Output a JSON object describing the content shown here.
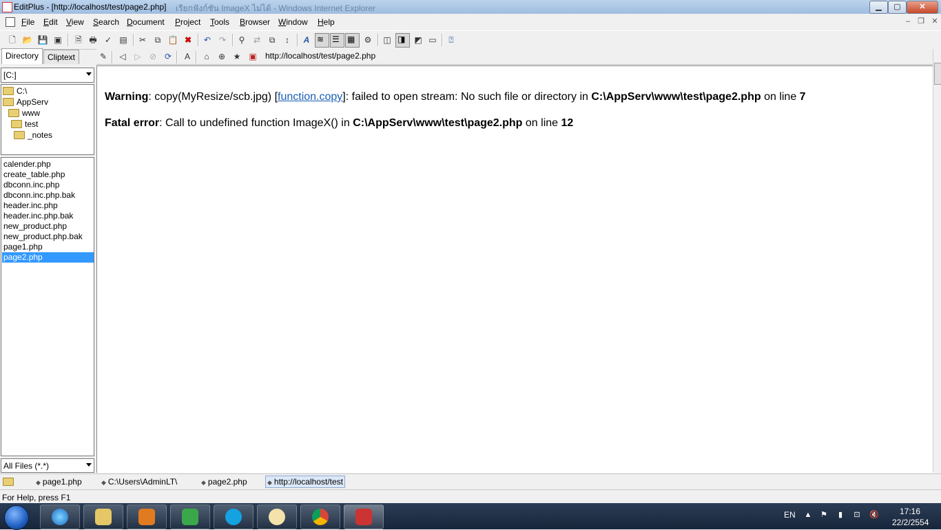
{
  "window": {
    "title": "EditPlus - [http://localhost/test/page2.php]",
    "ghost_title": "เรียกฟังก์ชัน ImageX ไม่ได้ - Windows Internet Explorer"
  },
  "menu": [
    {
      "label": "File",
      "accel": "F",
      "rest": "ile"
    },
    {
      "label": "Edit",
      "accel": "E",
      "rest": "dit"
    },
    {
      "label": "View",
      "accel": "V",
      "rest": "iew"
    },
    {
      "label": "Search",
      "accel": "S",
      "rest": "earch"
    },
    {
      "label": "Document",
      "accel": "D",
      "rest": "ocument"
    },
    {
      "label": "Project",
      "accel": "P",
      "rest": "roject"
    },
    {
      "label": "Tools",
      "accel": "T",
      "rest": "ools"
    },
    {
      "label": "Browser",
      "accel": "B",
      "rest": "rowser"
    },
    {
      "label": "Window",
      "accel": "W",
      "rest": "indow"
    },
    {
      "label": "Help",
      "accel": "H",
      "rest": "elp"
    }
  ],
  "sidebar": {
    "tabs": [
      "Directory",
      "Cliptext"
    ],
    "drive": "[C:]",
    "tree": [
      "C:\\",
      "AppServ",
      "www",
      "test",
      "_notes"
    ],
    "files": [
      "calender.php",
      "create_table.php",
      "dbconn.inc.php",
      "dbconn.inc.php.bak",
      "header.inc.php",
      "header.inc.php.bak",
      "new_product.php",
      "new_product.php.bak",
      "page1.php",
      "page2.php"
    ],
    "selected_file": "page2.php",
    "filter": "All Files (*.*)"
  },
  "browser": {
    "address": "http://localhost/test/page2.php"
  },
  "content": {
    "warning": {
      "label": "Warning",
      "text1": ": copy(MyResize/scb.jpg) [",
      "link": "function.copy",
      "text2": "]: failed to open stream: No such file or directory in ",
      "path": "C:\\AppServ\\www\\test\\page2.php",
      "text3": " on line ",
      "line": "7"
    },
    "fatal": {
      "label": "Fatal error",
      "text1": ": Call to undefined function ImageX() in ",
      "path": "C:\\AppServ\\www\\test\\page2.php",
      "text2": " on line ",
      "line": "12"
    }
  },
  "doc_tabs": [
    "page1.php",
    "C:\\Users\\AdminLT\\",
    "page2.php",
    "http://localhost/test"
  ],
  "status": "For Help, press F1",
  "taskbar": {
    "lang": "EN",
    "time": "17:16",
    "date": "22/2/2554"
  }
}
